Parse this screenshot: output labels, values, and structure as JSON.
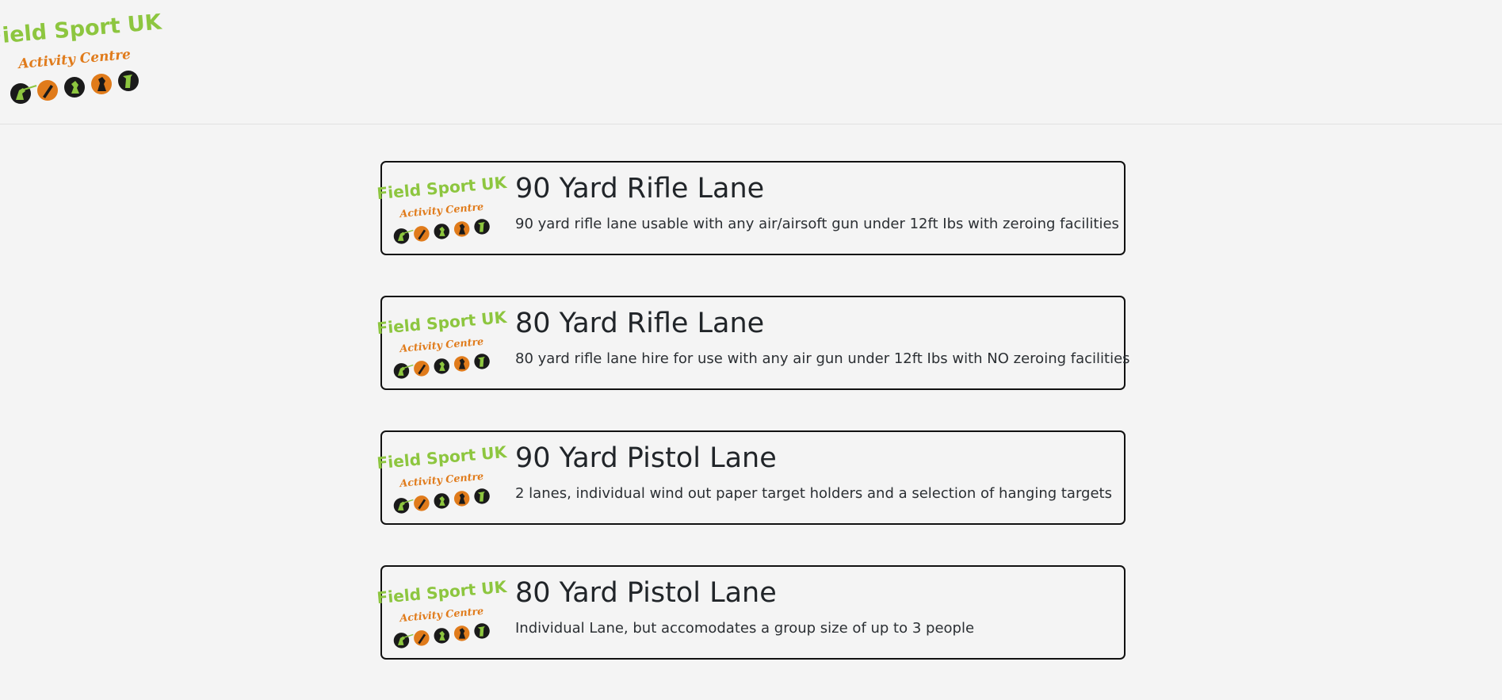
{
  "header": {
    "logo": {
      "title": "Field Sport UK",
      "subtitle": "Activity Centre",
      "icons": [
        "shooter-icon",
        "axe-icon",
        "runner-icon",
        "archer-icon",
        "rifleman-icon"
      ]
    }
  },
  "lanes": [
    {
      "title": "90 Yard Rifle Lane",
      "description": "90 yard rifle lane usable with any air/airsoft gun under 12ft Ibs with zeroing facilities"
    },
    {
      "title": "80 Yard Rifle Lane",
      "description": "80 yard rifle lane hire for use with any air gun under 12ft Ibs with NO zeroing facilities"
    },
    {
      "title": "90 Yard Pistol Lane",
      "description": "2 lanes, individual wind out paper target holders and a selection of hanging targets"
    },
    {
      "title": "80 Yard Pistol Lane",
      "description": "Individual Lane, but accomodates a group size of up to 3 people"
    }
  ],
  "colors": {
    "logo_green": "#8dc63f",
    "logo_orange": "#e07b1b",
    "logo_dark": "#1a1a1a",
    "card_border": "#111111",
    "background": "#f4f4f4"
  }
}
